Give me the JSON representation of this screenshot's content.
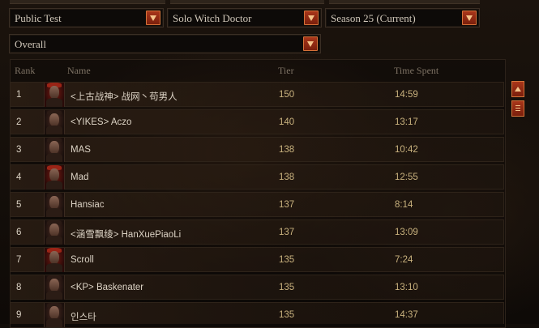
{
  "filters": {
    "region": "Public Test",
    "class": "Solo Witch Doctor",
    "season": "Season 25 (Current)",
    "category": "Overall"
  },
  "columns": {
    "rank": "Rank",
    "name": "Name",
    "tier": "Tier",
    "time": "Time Spent"
  },
  "rows": [
    {
      "rank": "1",
      "name": "<上古战神> 战网丶苟男人",
      "tier": "150",
      "time": "14:59",
      "portrait": "witch-doctor-female"
    },
    {
      "rank": "2",
      "name": "<YIKES> Aczo",
      "tier": "140",
      "time": "13:17",
      "portrait": "witch-doctor-male"
    },
    {
      "rank": "3",
      "name": "MAS",
      "tier": "138",
      "time": "10:42",
      "portrait": "witch-doctor-male"
    },
    {
      "rank": "4",
      "name": "Mad",
      "tier": "138",
      "time": "12:55",
      "portrait": "witch-doctor-female"
    },
    {
      "rank": "5",
      "name": "Hansiac",
      "tier": "137",
      "time": "8:14",
      "portrait": "witch-doctor-male"
    },
    {
      "rank": "6",
      "name": "<涵雪飘绫> HanXuePiaoLi",
      "tier": "137",
      "time": "13:09",
      "portrait": "witch-doctor-male"
    },
    {
      "rank": "7",
      "name": "Scroll",
      "tier": "135",
      "time": "7:24",
      "portrait": "witch-doctor-female"
    },
    {
      "rank": "8",
      "name": "<KP> Baskenater",
      "tier": "135",
      "time": "13:10",
      "portrait": "witch-doctor-male"
    },
    {
      "rank": "9",
      "name": "인스타",
      "tier": "135",
      "time": "14:37",
      "portrait": "witch-doctor-male"
    }
  ],
  "colors": {
    "accent": "#a8361a",
    "accent_border": "#d5743a",
    "text": "#dcd3c5",
    "value_text": "#c9b27e"
  },
  "icons": {
    "dropdown": "chevron-down-icon",
    "scroll_up": "arrow-up-icon",
    "scroll_thumb": "grip-icon"
  }
}
